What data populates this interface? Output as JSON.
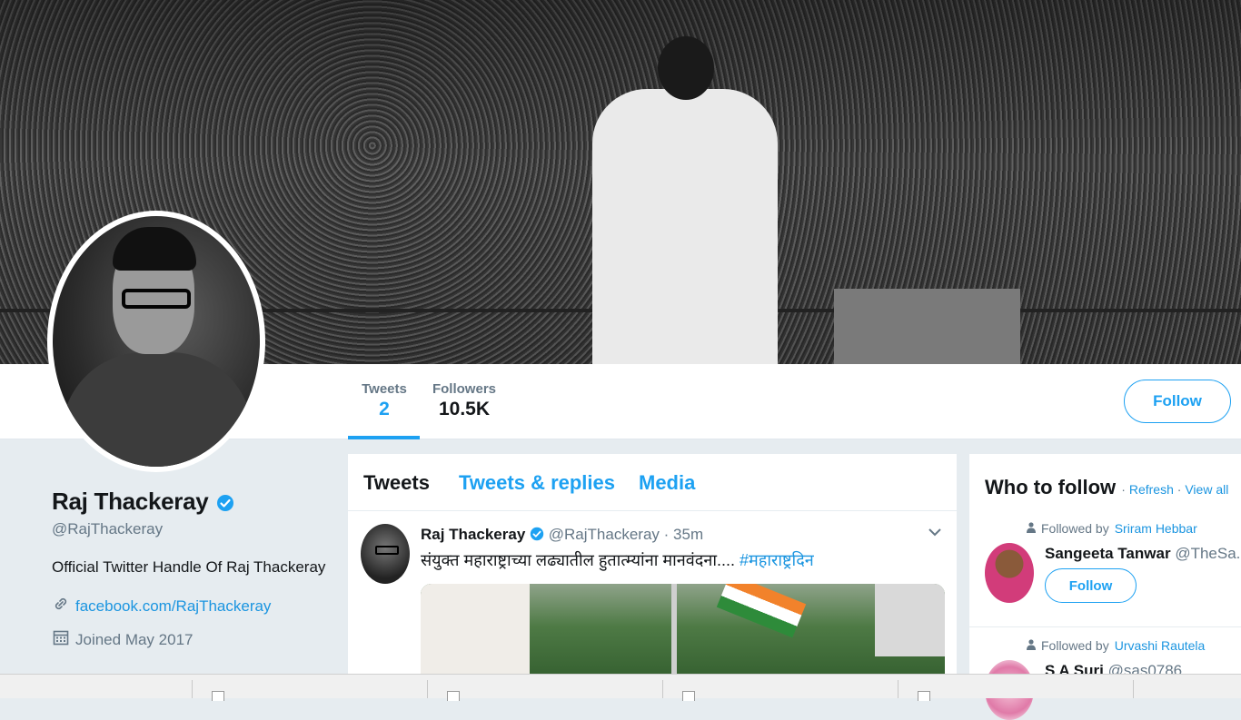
{
  "profile": {
    "name": "Raj Thackeray",
    "handle": "@RajThackeray",
    "bio": "Official Twitter Handle Of Raj Thackeray",
    "link": "facebook.com/RajThackeray",
    "joined": "Joined May 2017"
  },
  "stats": {
    "tweets_label": "Tweets",
    "tweets_value": "2",
    "followers_label": "Followers",
    "followers_value": "10.5K"
  },
  "follow_label": "Follow",
  "tabs": [
    "Tweets",
    "Tweets & replies",
    "Media"
  ],
  "tweet": {
    "name": "Raj Thackeray",
    "handle": "@RajThackeray",
    "dot": "·",
    "time": "35m",
    "text": "संयुक्त महाराष्ट्राच्या लढ्यातील हुतात्म्यांना मानवंदना.... ",
    "hashtag": "#महाराष्ट्रदिन"
  },
  "who_to_follow": {
    "title": "Who to follow",
    "refresh": "Refresh",
    "dot": "·",
    "view_all": "View all",
    "suggestions": [
      {
        "context": "Followed by",
        "context_user": "Sriram Hebbar",
        "name": "Sangeeta Tanwar",
        "handle": "@TheSa...",
        "button": "Follow"
      },
      {
        "context": "Followed by",
        "context_user": "Urvashi Rautela",
        "name": "S A Suri",
        "handle": "@sas0786"
      }
    ]
  },
  "colors": {
    "accent": "#1da1f2",
    "link": "#1b95e0",
    "muted": "#657786",
    "background": "#e6ecf0"
  },
  "icons": [
    "verified-badge-icon",
    "link-icon",
    "calendar-icon",
    "chevron-down-icon",
    "person-icon"
  ]
}
